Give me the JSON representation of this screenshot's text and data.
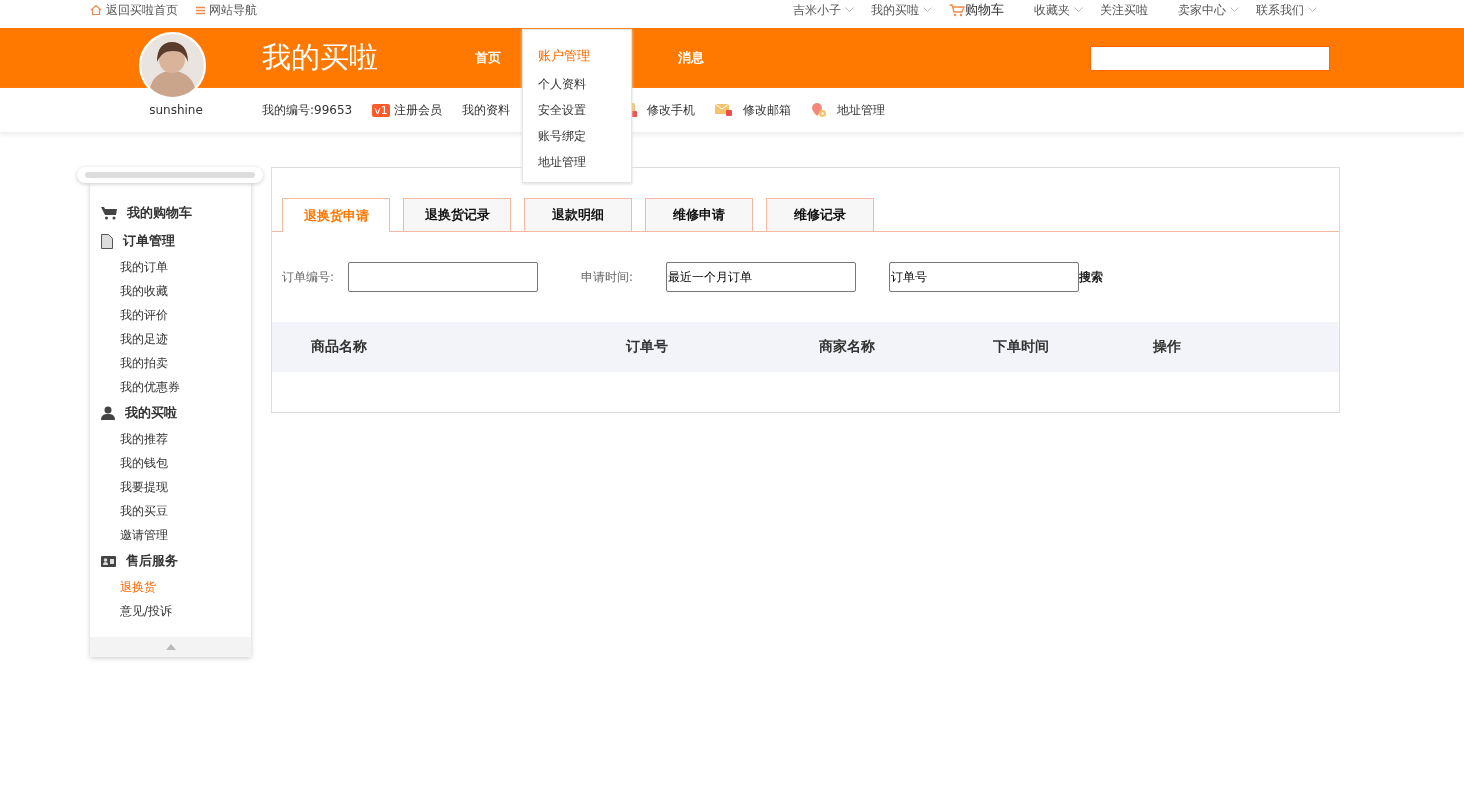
{
  "top_bar": {
    "left": [
      {
        "label": "返回买啦首页"
      },
      {
        "label": "网站导航"
      }
    ],
    "right": [
      {
        "label": "吉米小子",
        "dropdown": true
      },
      {
        "label": "我的买啦",
        "dropdown": true
      },
      {
        "label": "购物车",
        "dropdown": false,
        "kind": "cart"
      },
      {
        "label": "收藏夹",
        "dropdown": true
      },
      {
        "label": "关注买啦",
        "dropdown": false
      },
      {
        "label": "卖家中心",
        "dropdown": true
      },
      {
        "label": "联系我们",
        "dropdown": true
      }
    ]
  },
  "header": {
    "title": "我的买啦",
    "username": "sunshine",
    "nav": [
      {
        "label": "首页",
        "expanded": false
      },
      {
        "label": "账户管理",
        "expanded": true,
        "menu": [
          "个人资料",
          "安全设置",
          "账号绑定",
          "地址管理"
        ]
      },
      {
        "label": "消息",
        "expanded": false
      }
    ]
  },
  "profile_links": [
    {
      "label": "我的编号:99653"
    },
    {
      "label": "注册会员",
      "badge": "v1"
    },
    {
      "label": "我的资料"
    },
    {
      "label": "修改手机"
    },
    {
      "label": "修改邮箱"
    },
    {
      "label": "地址管理"
    }
  ],
  "sidebar": {
    "sections": [
      {
        "title": "我的购物车"
      },
      {
        "title": "订单管理",
        "items": [
          {
            "label": "我的订单",
            "selected": false
          },
          {
            "label": "我的收藏",
            "selected": false
          },
          {
            "label": "我的评价",
            "selected": false
          },
          {
            "label": "我的足迹",
            "selected": false
          },
          {
            "label": "我的拍卖",
            "selected": false
          },
          {
            "label": "我的优惠券",
            "selected": false
          }
        ]
      },
      {
        "title": "我的买啦",
        "items": [
          {
            "label": "我的推荐",
            "selected": false
          },
          {
            "label": "我的钱包",
            "selected": false
          },
          {
            "label": "我要提现",
            "selected": false
          },
          {
            "label": "我的买豆",
            "selected": false
          },
          {
            "label": "邀请管理",
            "selected": false
          }
        ]
      },
      {
        "title": "售后服务",
        "items": [
          {
            "label": "退换货",
            "selected": true
          },
          {
            "label": "意见/投诉",
            "selected": false
          }
        ]
      }
    ]
  },
  "tabs": [
    {
      "label": "退换货申请",
      "selected": true
    },
    {
      "label": "退换货记录",
      "selected": false
    },
    {
      "label": "退款明细",
      "selected": false
    },
    {
      "label": "维修申请",
      "selected": false
    },
    {
      "label": "维修记录",
      "selected": false
    }
  ],
  "filters": {
    "order_number_label": "订单编号:",
    "apply_time_label": "申请时间:",
    "apply_time_value": "最近一个月订单",
    "search_value": "订单号",
    "search_button": "搜索"
  },
  "table": {
    "columns": [
      "商品名称",
      "订单号",
      "商家名称",
      "下单时间",
      "操作"
    ]
  }
}
